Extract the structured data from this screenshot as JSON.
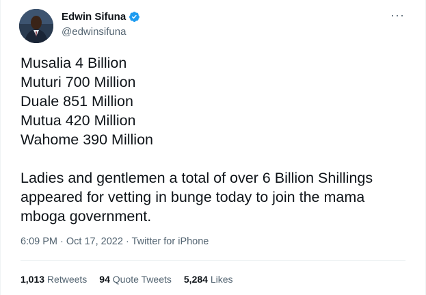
{
  "tweet": {
    "author": {
      "name": "Edwin Sifuna",
      "handle": "@edwinsifuna",
      "verified": true,
      "avatar_icon": "profile-photo"
    },
    "more_icon": "more-horizontal-icon",
    "more_glyph": "···",
    "lines": [
      "Musalia 4 Billion",
      "Muturi 700 Million",
      "Duale 851 Million",
      "Mutua 420 Million",
      "Wahome 390 Million"
    ],
    "paragraph": [
      "Ladies and gentlemen a total of over 6 Billion Shillings",
      "appeared for vetting in bunge today to join the mama",
      "mboga government."
    ],
    "time": "6:09 PM",
    "separator": " · ",
    "date": "Oct 17, 2022",
    "source": "Twitter for iPhone",
    "stats": {
      "retweets_count": "1,013",
      "retweets_label": " Retweets",
      "quotes_count": "94",
      "quotes_label": " Quote Tweets",
      "likes_count": "5,284",
      "likes_label": " Likes"
    },
    "colors": {
      "verified": "#1d9bf0",
      "secondary_text": "#536471",
      "primary_text": "#0f1419"
    }
  }
}
